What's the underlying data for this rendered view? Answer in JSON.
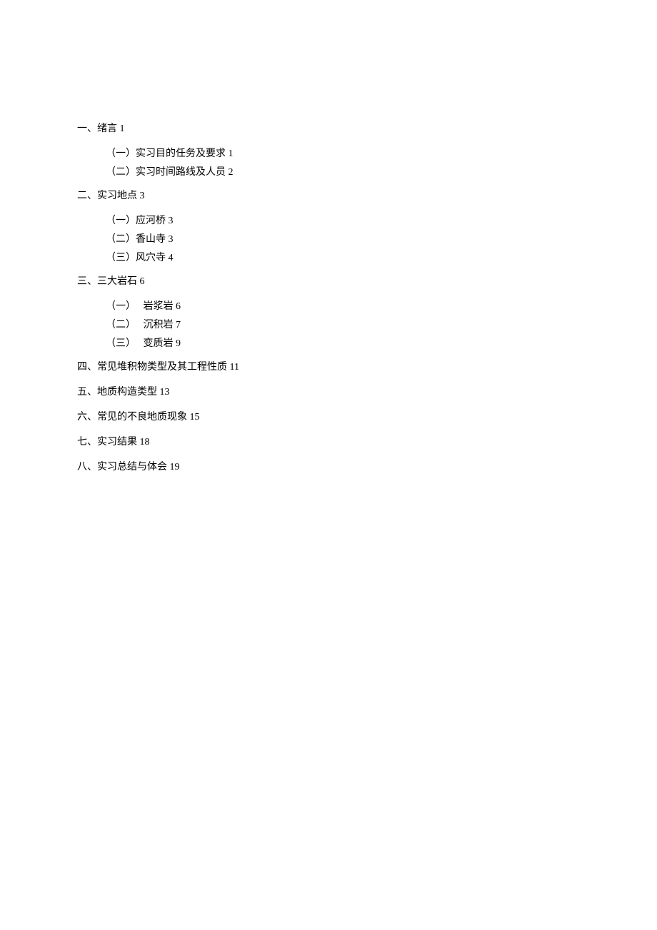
{
  "toc": {
    "s1": {
      "title": "一、绪言 1",
      "items": [
        "（一）实习目的任务及要求  1",
        "（二）实习时间路线及人员  2"
      ]
    },
    "s2": {
      "title": "二、实习地点  3",
      "items": [
        "（一）应河桥  3",
        "（二）香山寺  3",
        "（三）风穴寺  4"
      ]
    },
    "s3": {
      "title": "三、三大岩石  6",
      "items": [
        "（一）　 岩浆岩 6",
        "（二）　 沉积岩 7",
        "（三）　 变质岩 9"
      ]
    },
    "s4": {
      "title": "四、常见堆积物类型及其工程性质  11"
    },
    "s5": {
      "title": "五、地质构造类型  13"
    },
    "s6": {
      "title": "六、常见的不良地质现象  15"
    },
    "s7": {
      "title": "七、实习结果  18"
    },
    "s8": {
      "title": "八、实习总结与体会  19"
    }
  }
}
